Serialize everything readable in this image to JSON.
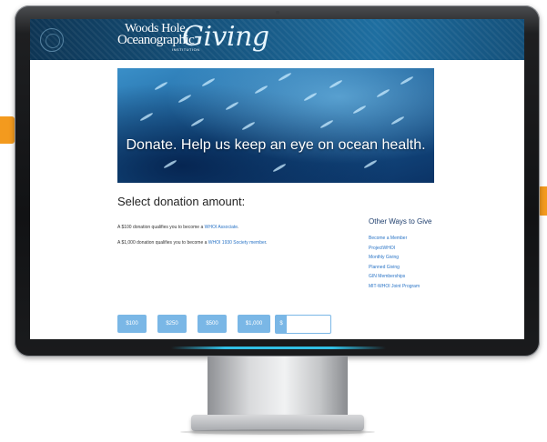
{
  "header": {
    "logo_line1": "Woods Hole",
    "logo_line2": "Oceanographic",
    "logo_line3": "INSTITUTION",
    "giving": "Giving"
  },
  "hero": {
    "caption": "Donate. Help us keep an eye on ocean health."
  },
  "donation": {
    "title": "Select donation amount:",
    "note1_prefix": "A $100 donation qualifies you to become a ",
    "note1_link": "WHOI Associate",
    "note1_suffix": ".",
    "note2_prefix": "A $1,000 donation qualifies you to become a ",
    "note2_link": "WHOI 1930 Society member",
    "note2_suffix": ".",
    "amounts": [
      "$100",
      "$250",
      "$500",
      "$1,000"
    ],
    "other_prefix": "$",
    "other_value": ""
  },
  "other_ways": {
    "title": "Other Ways to Give",
    "links": [
      "Become a Member",
      "ProjectWHOI",
      "Monthly Giving",
      "Planned Giving",
      "GIN Memberships",
      "MIT-WHOI Joint Program"
    ]
  },
  "colors": {
    "accent_orange": "#f39a1e",
    "header_blue": "#165580",
    "link_blue": "#2a74c6",
    "button_blue": "#7ab7e6",
    "glow_cyan": "#31c0e6"
  },
  "icons": [
    "camera-dot",
    "seal-emblem"
  ]
}
